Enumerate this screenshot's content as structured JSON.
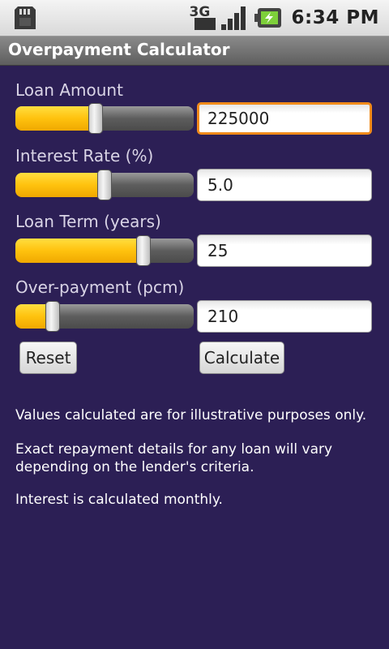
{
  "status_bar": {
    "time": "6:34 PM",
    "network": "3G",
    "icons": [
      "sd-card-icon",
      "3g-icon",
      "signal-icon",
      "battery-charging-icon"
    ]
  },
  "app": {
    "title": "Overpayment Calculator"
  },
  "form": {
    "loan_amount": {
      "label": "Loan Amount",
      "value": "225000",
      "slider_fraction": 0.45
    },
    "interest_rate": {
      "label": "Interest Rate (%)",
      "value": "5.0",
      "slider_fraction": 0.5
    },
    "loan_term": {
      "label": "Loan Term (years)",
      "value": "25",
      "slider_fraction": 0.72
    },
    "overpayment": {
      "label": "Over-payment (pcm)",
      "value": "210",
      "slider_fraction": 0.21
    }
  },
  "buttons": {
    "reset": "Reset",
    "calculate": "Calculate"
  },
  "notes": {
    "line1": "Values calculated are for illustrative purposes only.",
    "line2": "Exact repayment details for any loan will vary depending on the lender's criteria.",
    "line3": "Interest is calculated monthly."
  },
  "colors": {
    "background": "#2c1f55",
    "slider_fill": "#ffc20e",
    "focus": "#f08a1a"
  }
}
